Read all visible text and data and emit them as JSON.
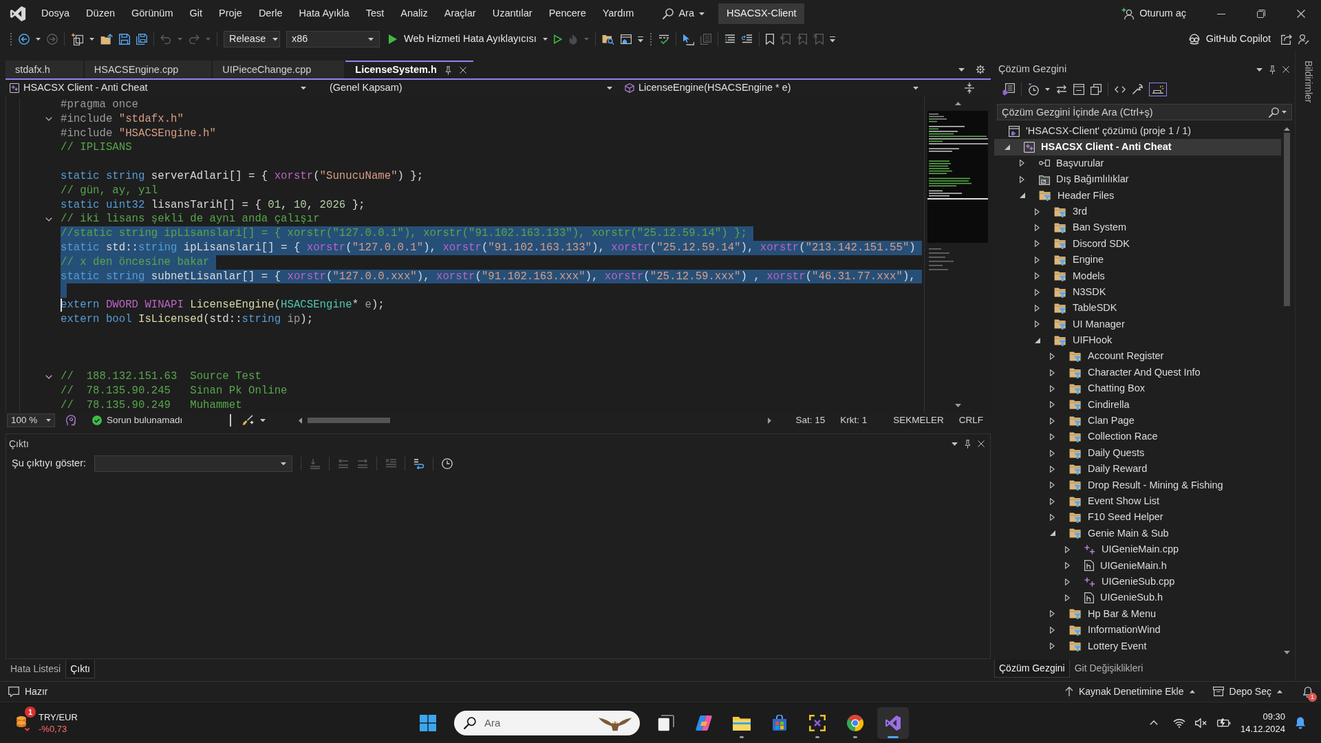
{
  "title_bar": {
    "menus": [
      "Dosya",
      "Düzen",
      "Görünüm",
      "Git",
      "Proje",
      "Derle",
      "Hata Ayıkla",
      "Test",
      "Analiz",
      "Araçlar",
      "Uzantılar",
      "Pencere",
      "Yardım"
    ],
    "search_label": "Ara",
    "solution_name": "HSACSX-Client",
    "sign_in": "Oturum aç"
  },
  "toolbar": {
    "configuration": "Release",
    "platform": "x86",
    "start_target": "Web Hizmeti Hata Ayıklayıcısı",
    "copilot": "GitHub Copilot"
  },
  "document_tabs": [
    {
      "label": "stdafx.h",
      "selected": false
    },
    {
      "label": "HSACSEngine.cpp",
      "selected": false
    },
    {
      "label": "UIPieceChange.cpp",
      "selected": false
    },
    {
      "label": "LicenseSystem.h",
      "selected": true
    }
  ],
  "navigation_bar": {
    "project": "HSACSX Client - Anti Cheat",
    "scope": "(Genel Kapsam)",
    "member": "LicenseEngine(HSACSEngine * e)"
  },
  "editor": {
    "lines": [
      {
        "tokens": [
          {
            "kind": "preprocessor",
            "text": "#pragma once"
          }
        ],
        "foldable": false,
        "selected": false,
        "caret": false
      },
      {
        "tokens": [
          {
            "kind": "preprocessor",
            "text": "#include "
          },
          {
            "kind": "string",
            "text": "\"stdafx.h\""
          }
        ],
        "foldable": true,
        "selected": false,
        "caret": false
      },
      {
        "tokens": [
          {
            "kind": "preprocessor",
            "text": "#include "
          },
          {
            "kind": "string",
            "text": "\"HSACSEngine.h\""
          }
        ],
        "foldable": false,
        "selected": false,
        "caret": false
      },
      {
        "tokens": [
          {
            "kind": "comment",
            "text": "// IPLISANS"
          }
        ],
        "foldable": false,
        "selected": false,
        "caret": false
      },
      {
        "foldable": false,
        "selected": false,
        "caret": false
      },
      {
        "tokens": [
          {
            "kind": "keyword",
            "text": "static"
          },
          {
            "kind": "keyword",
            "text": " string"
          },
          {
            "kind": "plain",
            "text": " serverAdlari[] = { "
          },
          {
            "kind": "macro",
            "text": "xorstr"
          },
          {
            "kind": "plain",
            "text": "("
          },
          {
            "kind": "string",
            "text": "\"SunucuName\""
          },
          {
            "kind": "plain",
            "text": ") };"
          }
        ],
        "foldable": false,
        "selected": false,
        "caret": false
      },
      {
        "tokens": [
          {
            "kind": "comment",
            "text": "// gün, ay, yıl"
          }
        ],
        "foldable": false,
        "selected": false,
        "caret": false
      },
      {
        "tokens": [
          {
            "kind": "keyword",
            "text": "static"
          },
          {
            "kind": "keyword",
            "text": " uint32"
          },
          {
            "kind": "plain",
            "text": " lisansTarih[] = { "
          },
          {
            "kind": "number",
            "text": "01"
          },
          {
            "kind": "plain",
            "text": ", "
          },
          {
            "kind": "number",
            "text": "10"
          },
          {
            "kind": "plain",
            "text": ", "
          },
          {
            "kind": "number",
            "text": "2026"
          },
          {
            "kind": "plain",
            "text": " };"
          }
        ],
        "foldable": false,
        "selected": false,
        "caret": false
      },
      {
        "tokens": [
          {
            "kind": "comment",
            "text": "// iki lisans şekli de aynı anda çalışır"
          }
        ],
        "foldable": true,
        "selected": false,
        "caret": false
      },
      {
        "tokens": [
          {
            "kind": "comment",
            "text": "//static string ipLisanslari[] = { xorstr(\"127.0.0.1\"), xorstr(\"91.102.163.133\"), xorstr(\"25.12.59.14\") };"
          }
        ],
        "foldable": false,
        "selected": true,
        "caret": false
      },
      {
        "tokens": [
          {
            "kind": "keyword",
            "text": "static"
          },
          {
            "kind": "plain",
            "text": " std::"
          },
          {
            "kind": "keyword",
            "text": "string"
          },
          {
            "kind": "plain",
            "text": " ipLisanslari[] = { "
          },
          {
            "kind": "macro",
            "text": "xorstr"
          },
          {
            "kind": "plain",
            "text": "("
          },
          {
            "kind": "string",
            "text": "\"127.0.0.1\""
          },
          {
            "kind": "plain",
            "text": "), "
          },
          {
            "kind": "macro",
            "text": "xorstr"
          },
          {
            "kind": "plain",
            "text": "("
          },
          {
            "kind": "string",
            "text": "\"91.102.163.133\""
          },
          {
            "kind": "plain",
            "text": "), "
          },
          {
            "kind": "macro",
            "text": "xorstr"
          },
          {
            "kind": "plain",
            "text": "("
          },
          {
            "kind": "string",
            "text": "\"25.12.59.14\""
          },
          {
            "kind": "plain",
            "text": "), "
          },
          {
            "kind": "macro",
            "text": "xorstr"
          },
          {
            "kind": "plain",
            "text": "("
          },
          {
            "kind": "string",
            "text": "\"213.142.151.55\""
          },
          {
            "kind": "plain",
            "text": ")"
          }
        ],
        "foldable": false,
        "selected": true,
        "caret": false
      },
      {
        "tokens": [
          {
            "kind": "comment",
            "text": "// x den öncesine bakar"
          }
        ],
        "foldable": false,
        "selected": true,
        "caret": false
      },
      {
        "tokens": [
          {
            "kind": "keyword",
            "text": "static"
          },
          {
            "kind": "keyword",
            "text": " string"
          },
          {
            "kind": "plain",
            "text": " subnetLisanlar[] = { "
          },
          {
            "kind": "macro",
            "text": "xorstr"
          },
          {
            "kind": "plain",
            "text": "("
          },
          {
            "kind": "string",
            "text": "\"127.0.0.xxx\""
          },
          {
            "kind": "plain",
            "text": "), "
          },
          {
            "kind": "macro",
            "text": "xorstr"
          },
          {
            "kind": "plain",
            "text": "("
          },
          {
            "kind": "string",
            "text": "\"91.102.163.xxx\""
          },
          {
            "kind": "plain",
            "text": "), "
          },
          {
            "kind": "macro",
            "text": "xorstr"
          },
          {
            "kind": "plain",
            "text": "("
          },
          {
            "kind": "string",
            "text": "\"25.12.59.xxx\""
          },
          {
            "kind": "plain",
            "text": ") , "
          },
          {
            "kind": "macro",
            "text": "xorstr"
          },
          {
            "kind": "plain",
            "text": "("
          },
          {
            "kind": "string",
            "text": "\"46.31.77.xxx\""
          },
          {
            "kind": "plain",
            "text": "),"
          }
        ],
        "foldable": false,
        "selected": true,
        "caret": false
      },
      {
        "foldable": false,
        "selected": true,
        "caret": false
      },
      {
        "tokens": [
          {
            "kind": "keyword",
            "text": "extern"
          },
          {
            "kind": "macro",
            "text": " DWORD"
          },
          {
            "kind": "macro",
            "text": " WINAPI"
          },
          {
            "kind": "function",
            "text": " LicenseEngine"
          },
          {
            "kind": "plain",
            "text": "("
          },
          {
            "kind": "type",
            "text": "HSACSEngine"
          },
          {
            "kind": "plain",
            "text": "* "
          },
          {
            "kind": "parameter",
            "text": "e"
          },
          {
            "kind": "plain",
            "text": ");"
          }
        ],
        "foldable": false,
        "selected": false,
        "caret": true
      },
      {
        "tokens": [
          {
            "kind": "keyword",
            "text": "extern"
          },
          {
            "kind": "keyword",
            "text": " bool"
          },
          {
            "kind": "function",
            "text": " IsLicensed"
          },
          {
            "kind": "plain",
            "text": "(std::"
          },
          {
            "kind": "keyword",
            "text": "string"
          },
          {
            "kind": "parameter",
            "text": " ip"
          },
          {
            "kind": "plain",
            "text": ");"
          }
        ],
        "foldable": false,
        "selected": false,
        "caret": false
      },
      {
        "foldable": false,
        "selected": false,
        "caret": false
      },
      {
        "foldable": false,
        "selected": false,
        "caret": false
      },
      {
        "foldable": false,
        "selected": false,
        "caret": false
      },
      {
        "tokens": [
          {
            "kind": "comment",
            "text": "//  188.132.151.63  Source Test"
          }
        ],
        "foldable": true,
        "selected": false,
        "caret": false
      },
      {
        "tokens": [
          {
            "kind": "comment",
            "text": "//  78.135.90.245   Sinan Pk Online"
          }
        ],
        "foldable": false,
        "selected": false,
        "caret": false
      },
      {
        "tokens": [
          {
            "kind": "comment",
            "text": "//  78.135.90.249   Muhammet"
          }
        ],
        "foldable": false,
        "selected": false,
        "caret": false
      }
    ]
  },
  "editor_status": {
    "zoom": "100 %",
    "issues": "Sorun bulunamadı",
    "line": "Sat: 15",
    "column": "Krkt: 1",
    "indentation": "SEKMELER",
    "line_ending": "CRLF"
  },
  "output_panel": {
    "title": "Çıktı",
    "source_label": "Şu çıktıyı göster:"
  },
  "bottom_tabs": [
    {
      "label": "Hata Listesi",
      "selected": false
    },
    {
      "label": "Çıktı",
      "selected": true
    }
  ],
  "solution_explorer": {
    "title": "Çözüm Gezgini",
    "search_placeholder": "Çözüm Gezgini İçinde Ara (Ctrl+ş)",
    "tree": [
      {
        "label": "'HSACSX-Client' çözümü (proje 1 / 1)",
        "kind": "solution",
        "selected": false,
        "children": [
          {
            "label": "HSACSX Client - Anti Cheat",
            "kind": "project",
            "expanded": true,
            "selected": true,
            "children": [
              {
                "label": "Başvurular",
                "kind": "references",
                "expanded": false,
                "selected": false
              },
              {
                "label": "Dış Bağımlılıklar",
                "kind": "external",
                "expanded": false,
                "selected": false
              },
              {
                "label": "Header Files",
                "kind": "filter",
                "expanded": true,
                "selected": false,
                "children": [
                  {
                    "label": "3rd",
                    "kind": "filter",
                    "expanded": false,
                    "selected": false
                  },
                  {
                    "label": "Ban System",
                    "kind": "filter",
                    "expanded": false,
                    "selected": false
                  },
                  {
                    "label": "Discord SDK",
                    "kind": "filter",
                    "expanded": false,
                    "selected": false
                  },
                  {
                    "label": "Engine",
                    "kind": "filter",
                    "expanded": false,
                    "selected": false
                  },
                  {
                    "label": "Models",
                    "kind": "filter",
                    "expanded": false,
                    "selected": false
                  },
                  {
                    "label": "N3SDK",
                    "kind": "filter",
                    "expanded": false,
                    "selected": false
                  },
                  {
                    "label": "TableSDK",
                    "kind": "filter",
                    "expanded": false,
                    "selected": false
                  },
                  {
                    "label": "UI Manager",
                    "kind": "filter",
                    "expanded": false,
                    "selected": false
                  },
                  {
                    "label": "UIFHook",
                    "kind": "filter",
                    "expanded": true,
                    "selected": false,
                    "children": [
                      {
                        "label": "Account Register",
                        "kind": "filter",
                        "expanded": false,
                        "selected": false
                      },
                      {
                        "label": "Character And Quest Info",
                        "kind": "filter",
                        "expanded": false,
                        "selected": false
                      },
                      {
                        "label": "Chatting Box",
                        "kind": "filter",
                        "expanded": false,
                        "selected": false
                      },
                      {
                        "label": "Cindirella",
                        "kind": "filter",
                        "expanded": false,
                        "selected": false
                      },
                      {
                        "label": "Clan Page",
                        "kind": "filter",
                        "expanded": false,
                        "selected": false
                      },
                      {
                        "label": "Collection Race",
                        "kind": "filter",
                        "expanded": false,
                        "selected": false
                      },
                      {
                        "label": "Daily Quests",
                        "kind": "filter",
                        "expanded": false,
                        "selected": false
                      },
                      {
                        "label": "Daily Reward",
                        "kind": "filter",
                        "expanded": false,
                        "selected": false
                      },
                      {
                        "label": "Drop Result - Mining & Fishing",
                        "kind": "filter",
                        "expanded": false,
                        "selected": false
                      },
                      {
                        "label": "Event Show List",
                        "kind": "filter",
                        "expanded": false,
                        "selected": false
                      },
                      {
                        "label": "F10 Seed Helper",
                        "kind": "filter",
                        "expanded": false,
                        "selected": false
                      },
                      {
                        "label": "Genie Main & Sub",
                        "kind": "filter",
                        "expanded": true,
                        "selected": false,
                        "children": [
                          {
                            "label": "UIGenieMain.cpp",
                            "kind": "cpp",
                            "expanded": false,
                            "selected": false
                          },
                          {
                            "label": "UIGenieMain.h",
                            "kind": "header",
                            "expanded": false,
                            "selected": false
                          },
                          {
                            "label": "UIGenieSub.cpp",
                            "kind": "cpp",
                            "expanded": false,
                            "selected": false
                          },
                          {
                            "label": "UIGenieSub.h",
                            "kind": "header",
                            "expanded": false,
                            "selected": false
                          }
                        ]
                      },
                      {
                        "label": "Hp Bar & Menu",
                        "kind": "filter",
                        "expanded": false,
                        "selected": false
                      },
                      {
                        "label": "InformationWind",
                        "kind": "filter",
                        "expanded": false,
                        "selected": false
                      },
                      {
                        "label": "Lottery Event",
                        "kind": "filter",
                        "expanded": false,
                        "selected": false
                      }
                    ]
                  }
                ]
              }
            ]
          }
        ]
      }
    ],
    "tabs": [
      {
        "label": "Çözüm Gezgini",
        "selected": true
      },
      {
        "label": "Git Değişiklikleri",
        "selected": false
      }
    ]
  },
  "notifications_tab": "Bildirimler",
  "status_bar": {
    "message": "Hazır",
    "source_control": "Kaynak Denetimine Ekle",
    "repository": "Depo Seç",
    "notification_count": "1"
  },
  "taskbar": {
    "widget": {
      "badge": "1",
      "title": "TRY/EUR",
      "value": "-%0,73"
    },
    "search_placeholder": "Ara",
    "apps": [
      {
        "kind": "task_view",
        "running": false,
        "active": false
      },
      {
        "kind": "assistant",
        "running": false,
        "active": false
      },
      {
        "kind": "file_manager",
        "running": true,
        "active": false
      },
      {
        "kind": "store",
        "running": false,
        "active": false
      },
      {
        "kind": "screenshot_tool",
        "running": true,
        "active": false
      },
      {
        "kind": "browser",
        "running": true,
        "active": false
      },
      {
        "kind": "ide",
        "running": true,
        "active": true
      }
    ],
    "time": "09:30",
    "date": "14.12.2024"
  }
}
